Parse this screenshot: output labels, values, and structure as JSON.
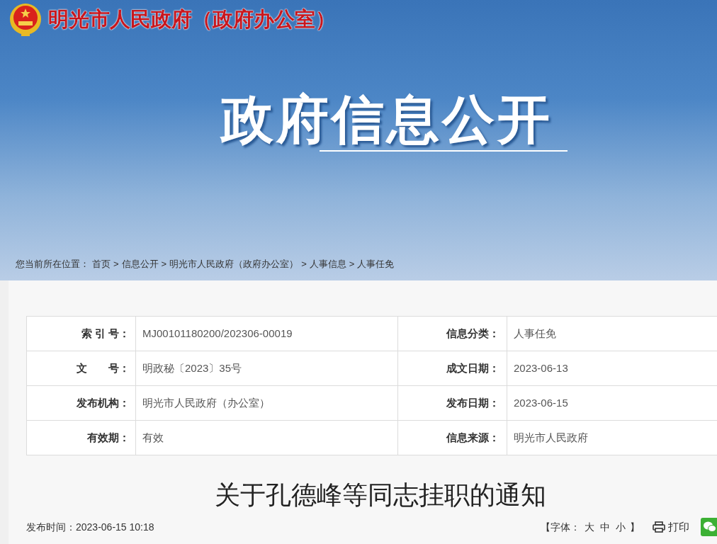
{
  "header": {
    "site_title": "明光市人民政府（政府办公室）",
    "banner_title": "政府信息公开"
  },
  "breadcrumb": {
    "label": "您当前所在位置：",
    "separator": ">",
    "items": [
      "首页",
      "信息公开",
      "明光市人民政府（政府办公室）",
      "人事信息",
      "人事任免"
    ]
  },
  "meta": [
    {
      "left": {
        "label": "索 引 号：",
        "value": "MJ00101180200/202306-00019"
      },
      "right": {
        "label": "信息分类：",
        "value": "人事任免"
      }
    },
    {
      "left": {
        "label": "文　　号：",
        "value": "明政秘〔2023〕35号"
      },
      "right": {
        "label": "成文日期：",
        "value": "2023-06-13"
      }
    },
    {
      "left": {
        "label": "发布机构：",
        "value": "明光市人民政府（办公室）"
      },
      "right": {
        "label": "发布日期：",
        "value": "2023-06-15"
      }
    },
    {
      "left": {
        "label": "有效期：",
        "value": "有效"
      },
      "right": {
        "label": "信息来源：",
        "value": "明光市人民政府"
      }
    }
  ],
  "article": {
    "title": "关于孔德峰等同志挂职的通知",
    "publish_time": "发布时间：2023-06-15 10:18",
    "font_open": "【字体：",
    "font_sizes": [
      "大",
      "中",
      "小"
    ],
    "font_close": "】",
    "print": "打印"
  }
}
